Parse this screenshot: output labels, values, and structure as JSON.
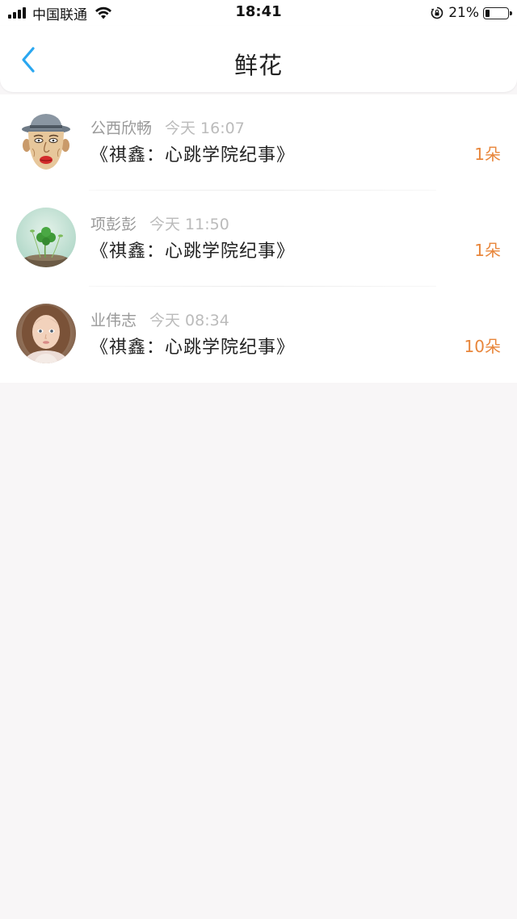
{
  "status_bar": {
    "carrier": "中国联通",
    "time": "18:41",
    "battery": "21%",
    "battery_level": 0.21
  },
  "nav": {
    "title": "鲜花",
    "back_icon": "chevron-left-icon"
  },
  "colors": {
    "accent_blue": "#2aa7f0",
    "count_orange": "#e8863b",
    "background": "#f8f6f7"
  },
  "records": [
    {
      "user": "公西欣畅",
      "time": "今天 16:07",
      "book": "《祺鑫：心跳学院纪事》",
      "count": "1朵",
      "avatar": "cartoon-old-man-avatar"
    },
    {
      "user": "项彭彭",
      "time": "今天 11:50",
      "book": "《祺鑫：心跳学院纪事》",
      "count": "1朵",
      "avatar": "clover-sprout-avatar"
    },
    {
      "user": "业伟志",
      "time": "今天 08:34",
      "book": "《祺鑫：心跳学院纪事》",
      "count": "10朵",
      "avatar": "girl-portrait-avatar"
    }
  ]
}
